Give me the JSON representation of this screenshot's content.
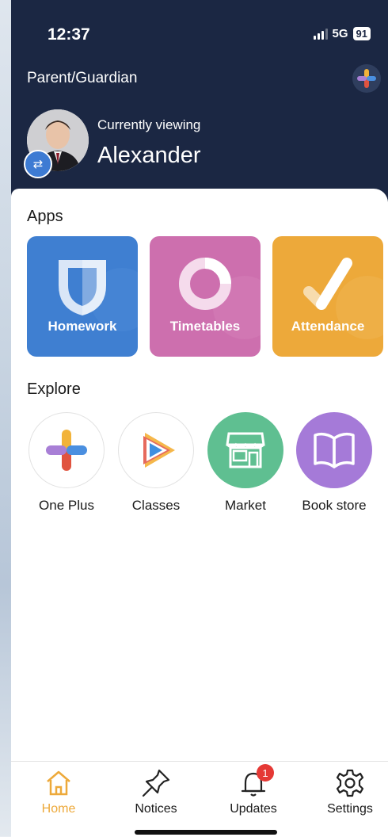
{
  "status": {
    "time": "12:37",
    "network": "5G",
    "battery": "91"
  },
  "header": {
    "role": "Parent/Guardian",
    "viewing_label": "Currently viewing",
    "child_name": "Alexander"
  },
  "apps": {
    "title": "Apps",
    "items": [
      {
        "label": "Homework",
        "color": "#3f7fd1",
        "icon": "shield-icon"
      },
      {
        "label": "Timetables",
        "color": "#cd6fae",
        "icon": "donut-icon"
      },
      {
        "label": "Attendance",
        "color": "#eda93a",
        "icon": "check-icon"
      }
    ]
  },
  "explore": {
    "title": "Explore",
    "items": [
      {
        "label": "One Plus",
        "icon": "plus-icon"
      },
      {
        "label": "Classes",
        "icon": "play-icon"
      },
      {
        "label": "Market",
        "icon": "shop-icon",
        "color": "#5fbf91"
      },
      {
        "label": "Book store",
        "icon": "book-icon",
        "color": "#a57ad8"
      }
    ]
  },
  "tabs": [
    {
      "label": "Home",
      "icon": "home-icon",
      "active": true,
      "color": "#eda93a"
    },
    {
      "label": "Notices",
      "icon": "pin-icon"
    },
    {
      "label": "Updates",
      "icon": "bell-icon",
      "badge": "1"
    },
    {
      "label": "Settings",
      "icon": "gear-icon"
    }
  ]
}
